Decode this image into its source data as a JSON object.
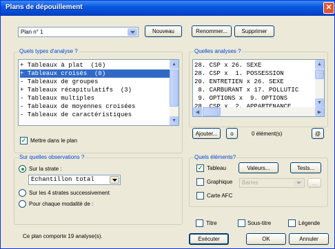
{
  "window": {
    "title": "Plans de dépouillement",
    "close_glyph": "✕"
  },
  "top": {
    "plan_value": "Plan n° 1",
    "new_label": "Nouveau",
    "rename_label": "Renommer...",
    "delete_label": "Supprimer"
  },
  "types": {
    "group_label": "Quels types d'analyse ?",
    "items": [
      "+ Tableaux à plat  (16)",
      "+ Tableaux croisés  (0)",
      "- Tableaux de groupes",
      "+ Tableaux récapitulatifs  (3)",
      "- Tableaux multiples",
      "- Tableaux de moyennes croisées",
      "- Tableaux de caractéristiques"
    ],
    "selected_index": 1,
    "checkbox_label": "Mettre dans le plan",
    "checkbox_checked": true
  },
  "analyses": {
    "group_label": "Quelles analyses ?",
    "items": [
      "28. CSP x 26. SEXE",
      "28. CSP x  1. POSSESSION",
      "20. ENTRETIEN x 26. SEXE",
      " 8. CARBURANT x 17. POLLUTIC",
      " 9. OPTIONS x  9. OPTIONS",
      "28. CSP x  2. APPARTENANCE"
    ],
    "add_label": "Ajouter...",
    "o_label": "o",
    "count_text": "0 élément(s)",
    "at_label": "@"
  },
  "observations": {
    "group_label": "Sur quelles observations ?",
    "strata_label": "Sur la strate :",
    "strata_value": "Echantillon total",
    "successive_label": "Sur les 4 strates successivement",
    "each_label": "Pour chaque modalité de :"
  },
  "elements": {
    "group_label": "Quels éléments?",
    "tableau_label": "Tableau",
    "tableau_checked": true,
    "values_label": "Valeurs...",
    "tests_label": "Tests...",
    "graphique_label": "Graphique",
    "graph_type": "Barres",
    "graph_more": "...",
    "afc_label": "Carte AFC"
  },
  "options": {
    "title_label": "Titre",
    "subtitle_label": "Sous-titre",
    "legend_label": "Légende"
  },
  "footer": {
    "status_text": "Ce plan comporte 19 analyse(s).",
    "execute_label": "Exécuter",
    "ok_label": "OK",
    "cancel_label": "Annuler"
  }
}
